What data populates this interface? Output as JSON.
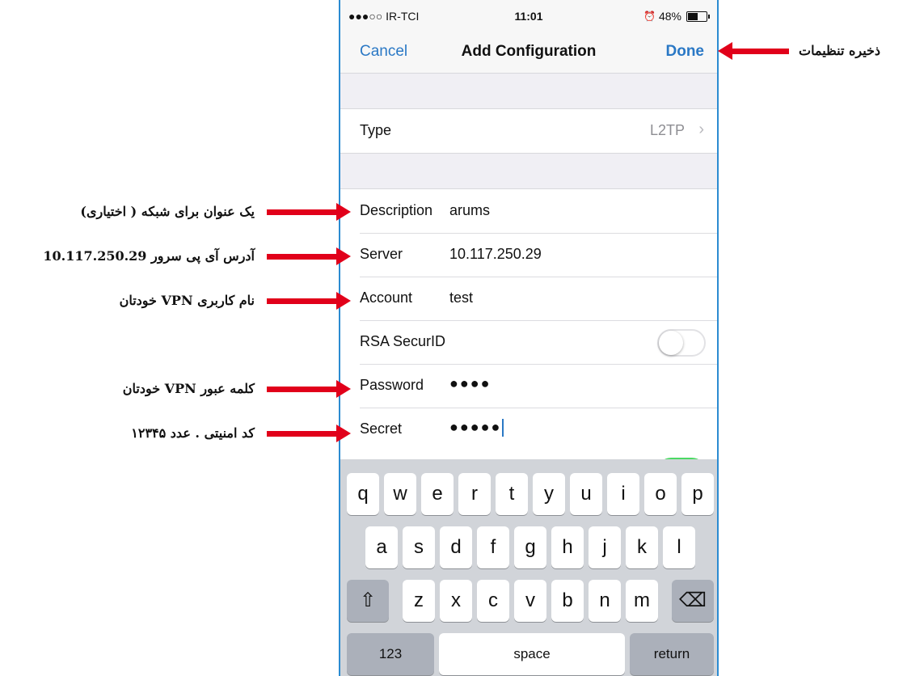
{
  "status_bar": {
    "carrier": "●●●○○ IR-TCI",
    "time": "11:01",
    "battery": "48%"
  },
  "nav": {
    "cancel": "Cancel",
    "title": "Add Configuration",
    "done": "Done"
  },
  "type_row": {
    "label": "Type",
    "value": "L2TP",
    "chevron": "›"
  },
  "form": {
    "description": {
      "label": "Description",
      "value": "arums"
    },
    "server": {
      "label": "Server",
      "value": "10.117.250.29"
    },
    "account": {
      "label": "Account",
      "value": "test"
    },
    "rsa": {
      "label": "RSA SecurID",
      "on": false
    },
    "password": {
      "label": "Password",
      "value": "●●●●"
    },
    "secret": {
      "label": "Secret",
      "value": "●●●●●"
    }
  },
  "keyboard": {
    "row1": [
      "q",
      "w",
      "e",
      "r",
      "t",
      "y",
      "u",
      "i",
      "o",
      "p"
    ],
    "row2": [
      "a",
      "s",
      "d",
      "f",
      "g",
      "h",
      "j",
      "k",
      "l"
    ],
    "row3": [
      "z",
      "x",
      "c",
      "v",
      "b",
      "n",
      "m"
    ],
    "shift": "⇧",
    "backspace": "⌫",
    "numbers": "123",
    "space": "space",
    "return": "return"
  },
  "annotations": {
    "done": "ذخیره تنظیمات",
    "description": "یک عنوان برای شبکه ( اختیاری)",
    "server": "آدرس آی پی سرور 10.117.250.29",
    "account": "نام کاربری VPN خودتان",
    "password": "کلمه عبور VPN خودتان",
    "secret": "کد امنیتی . عدد ۱۲۳۴۵"
  },
  "colors": {
    "accent": "#2a78c5",
    "arrow": "#e1001a",
    "frame": "#2b8bd1"
  }
}
